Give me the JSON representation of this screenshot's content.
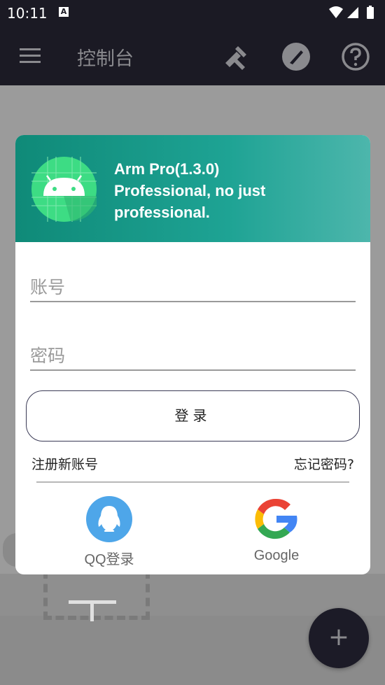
{
  "status_bar": {
    "time": "10:11",
    "app_glyph": "A"
  },
  "app_bar": {
    "title": "控制台",
    "icons": [
      "menu-icon",
      "tools-icon",
      "clean-icon",
      "help-icon"
    ]
  },
  "dialog": {
    "app_name": "Arm Pro(1.3.0)",
    "tagline": "Professional, no just professional.",
    "account_placeholder": "账号",
    "password_placeholder": "密码",
    "login_label": "登录",
    "register_link": "注册新账号",
    "forgot_link": "忘记密码?",
    "qq_label": "QQ登录",
    "google_label": "Google"
  },
  "fab": {
    "label": "+"
  },
  "colors": {
    "accent": "#1ea394",
    "bar": "#1b1a24"
  }
}
